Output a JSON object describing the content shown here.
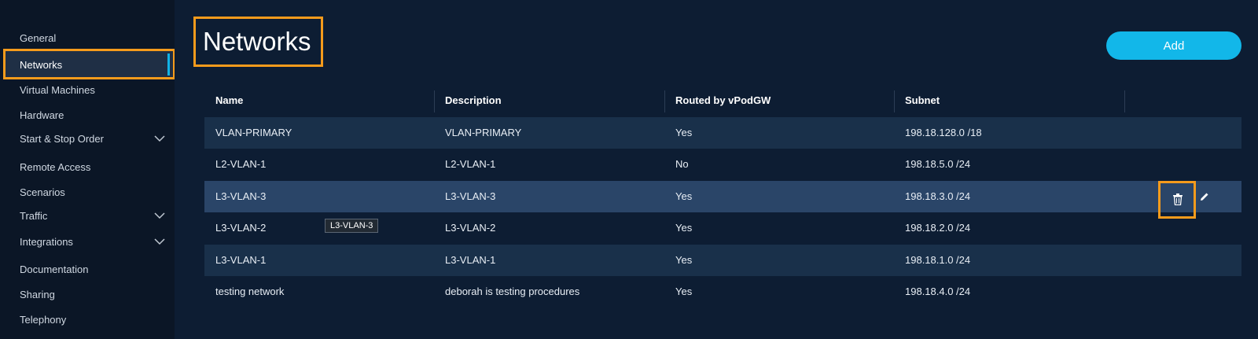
{
  "sidebar": {
    "items": [
      {
        "label": "General"
      },
      {
        "label": "Networks"
      },
      {
        "label": "Virtual Machines"
      },
      {
        "label": "Hardware"
      },
      {
        "label": "Start & Stop Order"
      },
      {
        "label": "Remote Access"
      },
      {
        "label": "Scenarios"
      },
      {
        "label": "Traffic"
      },
      {
        "label": "Integrations"
      },
      {
        "label": "Documentation"
      },
      {
        "label": "Sharing"
      },
      {
        "label": "Telephony"
      }
    ],
    "active": "Networks",
    "expandable_icon": "chevron-down-icon"
  },
  "page": {
    "title": "Networks",
    "add_label": "Add"
  },
  "table": {
    "columns": [
      "Name",
      "Description",
      "Routed by vPodGW",
      "Subnet"
    ],
    "rows": [
      [
        "VLAN-PRIMARY",
        "VLAN-PRIMARY",
        "Yes",
        "198.18.128.0 /18"
      ],
      [
        "L2-VLAN-1",
        "L2-VLAN-1",
        "No",
        "198.18.5.0 /24"
      ],
      [
        "L3-VLAN-3",
        "L3-VLAN-3",
        "Yes",
        "198.18.3.0 /24"
      ],
      [
        "L3-VLAN-2",
        "L3-VLAN-2",
        "Yes",
        "198.18.2.0 /24"
      ],
      [
        "L3-VLAN-1",
        "L3-VLAN-1",
        "Yes",
        "198.18.1.0 /24"
      ],
      [
        "testing network",
        "deborah is testing procedures",
        "Yes",
        "198.18.4.0 /24"
      ]
    ],
    "row_actions": [
      "trash-icon",
      "pencil-icon"
    ]
  },
  "tooltip": "L3-VLAN-3",
  "colors": {
    "accent": "#12b7e9",
    "highlight_border": "#f59b1c",
    "background": "#0d1d33"
  }
}
